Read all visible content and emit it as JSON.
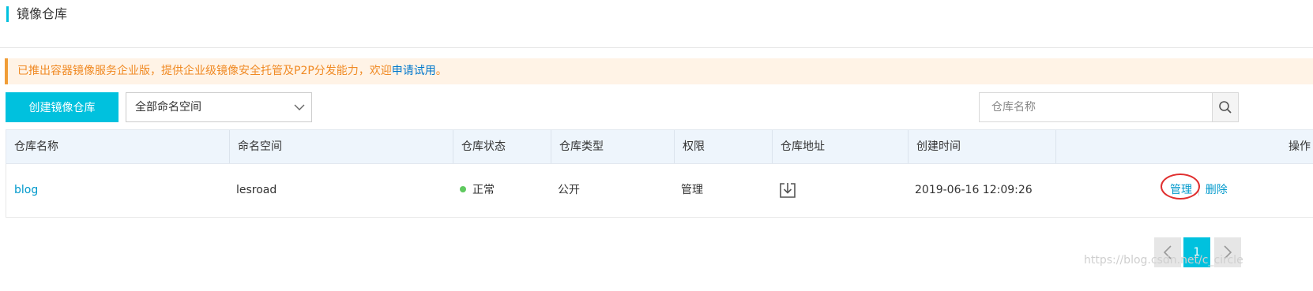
{
  "page_title": "镜像仓库",
  "notice": {
    "text": "已推出容器镜像服务企业版，提供企业级镜像安全托管及P2P分发能力，欢迎",
    "link": "申请试用",
    "suffix": "。"
  },
  "toolbar": {
    "create_label": "创建镜像仓库",
    "namespace_select": "全部命名空间",
    "search_placeholder": "仓库名称"
  },
  "table": {
    "headers": [
      "仓库名称",
      "命名空间",
      "仓库状态",
      "仓库类型",
      "权限",
      "仓库地址",
      "创建时间",
      "操作"
    ],
    "rows": [
      {
        "name": "blog",
        "namespace": "lesroad",
        "status": "正常",
        "type": "公开",
        "permission": "管理",
        "address_icon": "download-icon",
        "created": "2019-06-16 12:09:26",
        "actions": [
          "管理",
          "删除"
        ]
      }
    ]
  },
  "pagination": {
    "current": "1"
  },
  "watermark": "https://blog.csdn.net/c_circle",
  "colors": {
    "accent": "#00c1de",
    "notice_text": "#f08a24",
    "notice_bg": "#fff3e6",
    "link": "#0099cc",
    "status_ok": "#5fc95f",
    "highlight_ring": "#e02f2f"
  }
}
